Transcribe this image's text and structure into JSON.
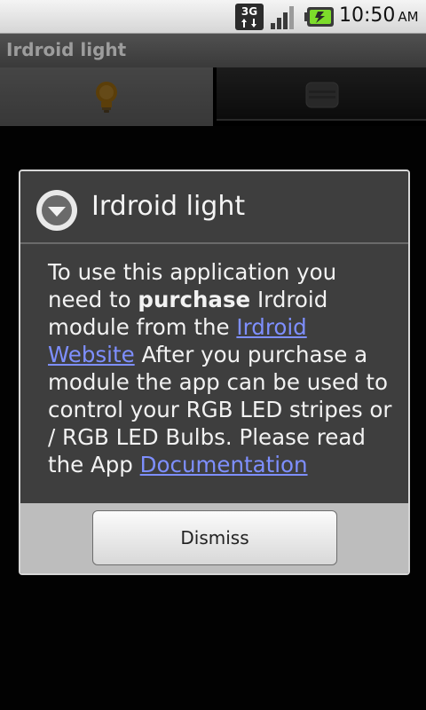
{
  "status_bar": {
    "network": "3G",
    "time": "10:50",
    "ampm": "AM",
    "icons": [
      "3g-data-icon",
      "signal-icon",
      "battery-charging-icon"
    ]
  },
  "app": {
    "title": "Irdroid light"
  },
  "tabs": [
    {
      "icon": "lightbulb-icon",
      "selected": true
    },
    {
      "icon": "remote-icon",
      "selected": false
    }
  ],
  "dialog": {
    "icon": "info-arrow-icon",
    "title": "Irdroid light",
    "message": {
      "part1": "To use this application you need to ",
      "bold": "purchase",
      "part2": " Irdroid module from the ",
      "link1": "Irdroid Website",
      "part3": " After you purchase a module the app can be used to control your RGB LED stripes or / RGB LED Bulbs. Please read the App ",
      "link2": "Documentation"
    },
    "dismiss_label": "Dismiss"
  },
  "colors": {
    "link": "#7e8fff",
    "dialog_bg": "#3e3e3e",
    "footer_bg": "#bdbdbd"
  }
}
